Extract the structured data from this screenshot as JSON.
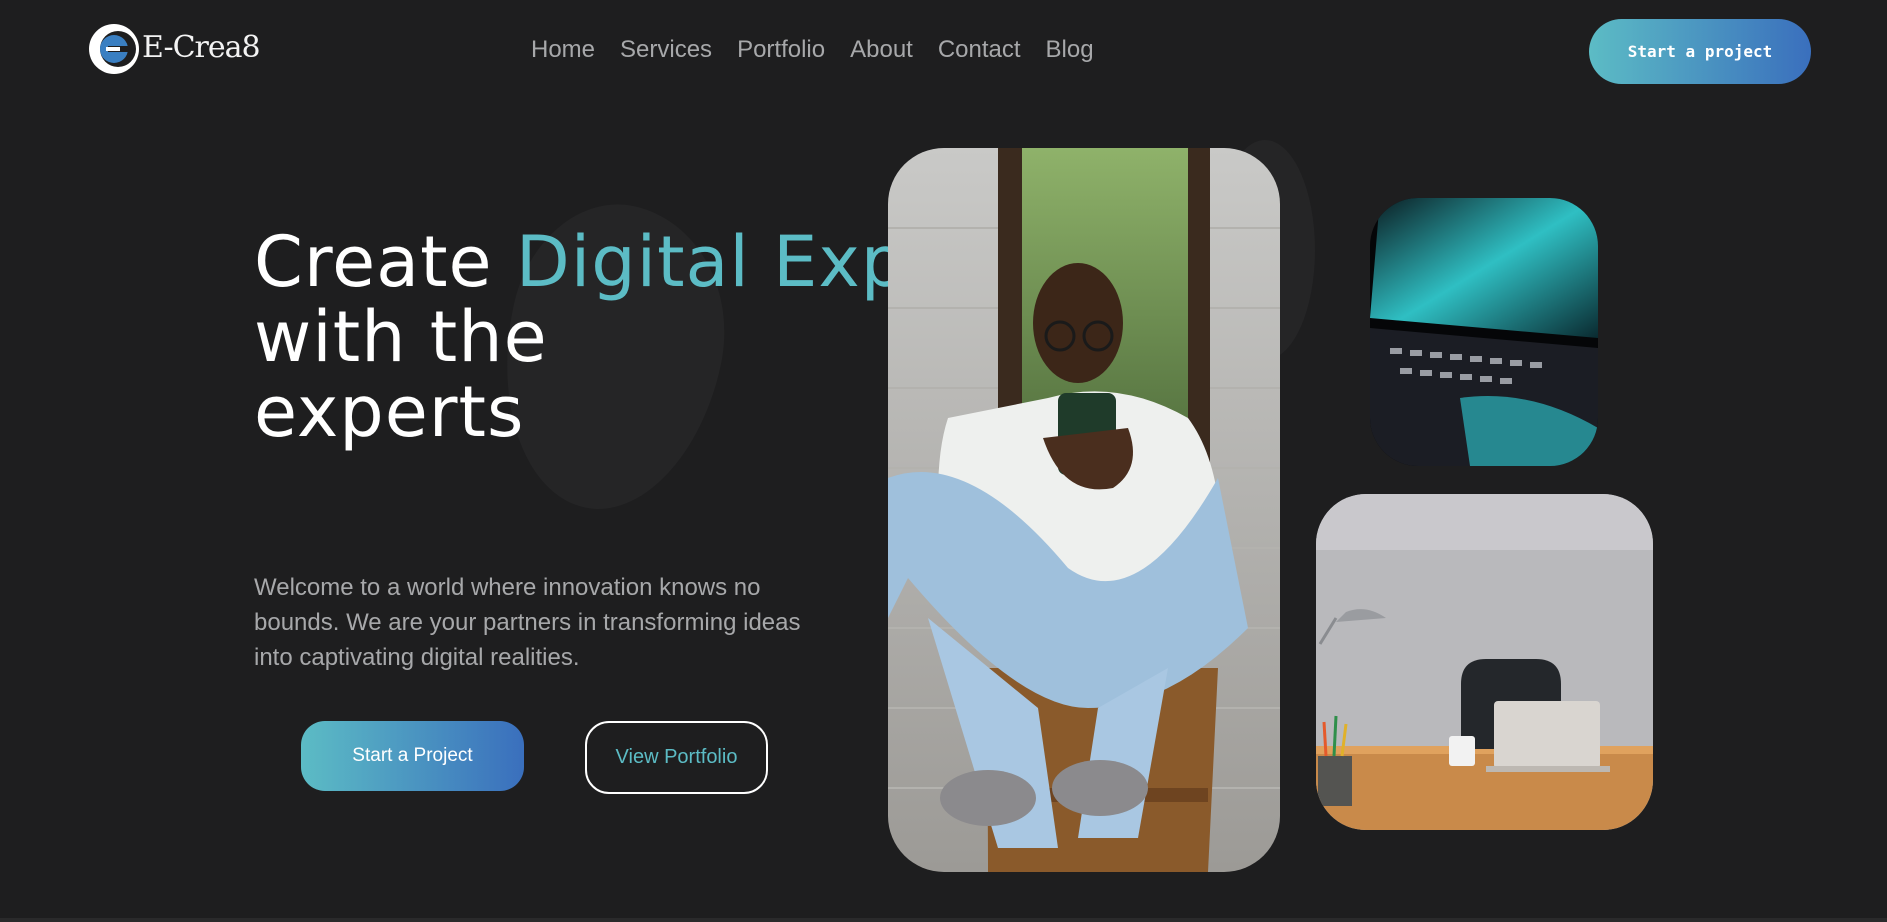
{
  "brand": {
    "name": "E-Crea8"
  },
  "nav": {
    "items": [
      "Home",
      "Services",
      "Portfolio",
      "About",
      "Contact",
      "Blog"
    ]
  },
  "header": {
    "cta_label": "Start a project"
  },
  "hero": {
    "headline_part1": "Create ",
    "headline_accent": "Digital Experiences",
    "headline_part2": "with the experts",
    "intro": "Welcome to a world where innovation knows no bounds. We are your partners in transforming ideas into captivating digital realities.",
    "primary_cta": "Start a Project",
    "secondary_cta": "View Portfolio"
  },
  "colors": {
    "background": "#1e1e1f",
    "accent": "#5cbcc5",
    "gradient_start": "#5cbcc5",
    "gradient_end": "#3a6fbd",
    "nav_text": "#a7a8aa"
  }
}
